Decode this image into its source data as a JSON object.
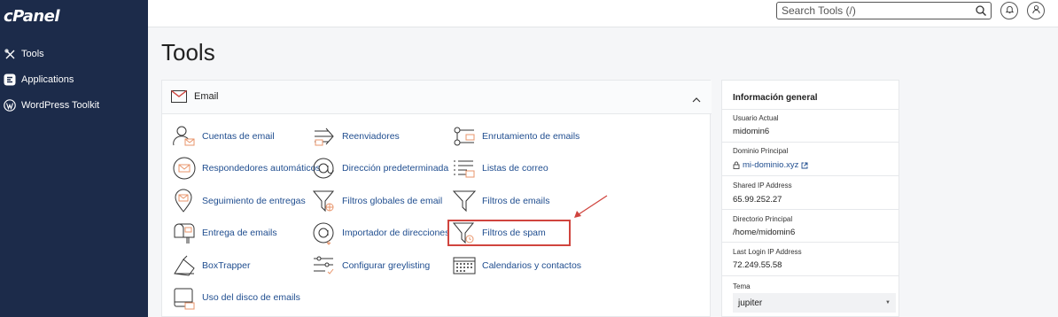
{
  "sidebar": {
    "logo": "cPanel",
    "items": [
      {
        "label": "Tools",
        "icon": "tools-icon"
      },
      {
        "label": "Applications",
        "icon": "applications-icon"
      },
      {
        "label": "WordPress Toolkit",
        "icon": "wordpress-icon"
      }
    ]
  },
  "header": {
    "search_placeholder": "Search Tools (/)"
  },
  "page": {
    "title": "Tools"
  },
  "email_panel": {
    "title": "Email",
    "tools": [
      {
        "label": "Cuentas de email",
        "icon": "email-accounts-icon"
      },
      {
        "label": "Reenviadores",
        "icon": "forwarders-icon"
      },
      {
        "label": "Enrutamiento de emails",
        "icon": "email-routing-icon"
      },
      {
        "label": "Respondedores automáticos",
        "icon": "autoresponders-icon"
      },
      {
        "label": "Dirección predeterminada",
        "icon": "default-address-icon"
      },
      {
        "label": "Listas de correo",
        "icon": "mailing-lists-icon"
      },
      {
        "label": "Seguimiento de entregas",
        "icon": "track-delivery-icon"
      },
      {
        "label": "Filtros globales de email",
        "icon": "global-filters-icon"
      },
      {
        "label": "Filtros de emails",
        "icon": "email-filters-icon"
      },
      {
        "label": "Entrega de emails",
        "icon": "email-delivery-icon"
      },
      {
        "label": "Importador de direcciones",
        "icon": "address-importer-icon"
      },
      {
        "label": "Filtros de spam",
        "icon": "spam-filters-icon"
      },
      {
        "label": "BoxTrapper",
        "icon": "boxtrapper-icon"
      },
      {
        "label": "Configurar greylisting",
        "icon": "greylisting-icon"
      },
      {
        "label": "Calendarios y contactos",
        "icon": "calendars-icon"
      },
      {
        "label": "Uso del disco de emails",
        "icon": "email-disk-usage-icon"
      }
    ]
  },
  "general_info": {
    "title": "Información general",
    "current_user_label": "Usuario Actual",
    "current_user": "midomin6",
    "primary_domain_label": "Dominio Principal",
    "primary_domain": "mi-dominio.xyz",
    "shared_ip_label": "Shared IP Address",
    "shared_ip": "65.99.252.27",
    "home_dir_label": "Directorio Principal",
    "home_dir": "/home/midomin6",
    "last_login_label": "Last Login IP Address",
    "last_login": "72.249.55.58",
    "theme_label": "Tema",
    "theme": "jupiter"
  },
  "colors": {
    "sidebar_bg": "#1c2b4a",
    "link": "#1f4d8f",
    "highlight": "#d0443e",
    "icon_accent": "#e8956b"
  }
}
